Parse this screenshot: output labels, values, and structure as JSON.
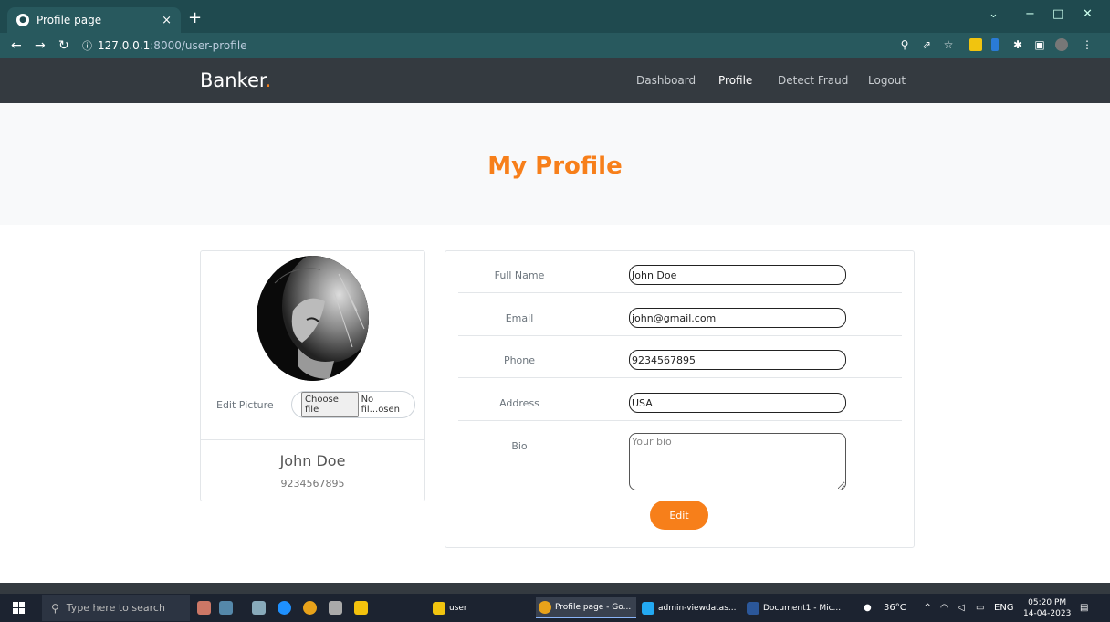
{
  "browser": {
    "tab_title": "Profile page",
    "tab_close": "×",
    "new_tab": "+",
    "url_host": "127.0.0.1",
    "url_path": ":8000/user-profile",
    "controls": {
      "minimize": "−",
      "restore": "□",
      "close": "✕",
      "dropdown": "⌄"
    }
  },
  "site": {
    "brand": "Banker",
    "brand_dot": ".",
    "nav": [
      {
        "label": "Dashboard"
      },
      {
        "label": "Profile"
      },
      {
        "label": "Detect Fraud"
      },
      {
        "label": "Logout"
      }
    ],
    "accent_color": "#f77f1a",
    "page_title": "My Profile"
  },
  "profile_card": {
    "edit_picture_label": "Edit Picture",
    "choose_file": "Choose file",
    "file_status": "No fil...osen",
    "name": "John Doe",
    "phone": "9234567895"
  },
  "form": {
    "fields": [
      {
        "label": "Full Name",
        "value": "John Doe"
      },
      {
        "label": "Email",
        "value": "john@gmail.com"
      },
      {
        "label": "Phone",
        "value": "9234567895"
      },
      {
        "label": "Address",
        "value": "USA"
      }
    ],
    "bio_label": "Bio",
    "bio_placeholder": "Your bio",
    "submit_label": "Edit"
  },
  "taskbar": {
    "search_placeholder": "Type here to search",
    "apps": [
      {
        "label": "user"
      },
      {
        "label": "Profile page - Go..."
      },
      {
        "label": "admin-viewdatas..."
      },
      {
        "label": "Document1 - Mic..."
      }
    ],
    "weather": "36°C",
    "language": "ENG",
    "time": "05:20 PM",
    "date": "14-04-2023"
  }
}
